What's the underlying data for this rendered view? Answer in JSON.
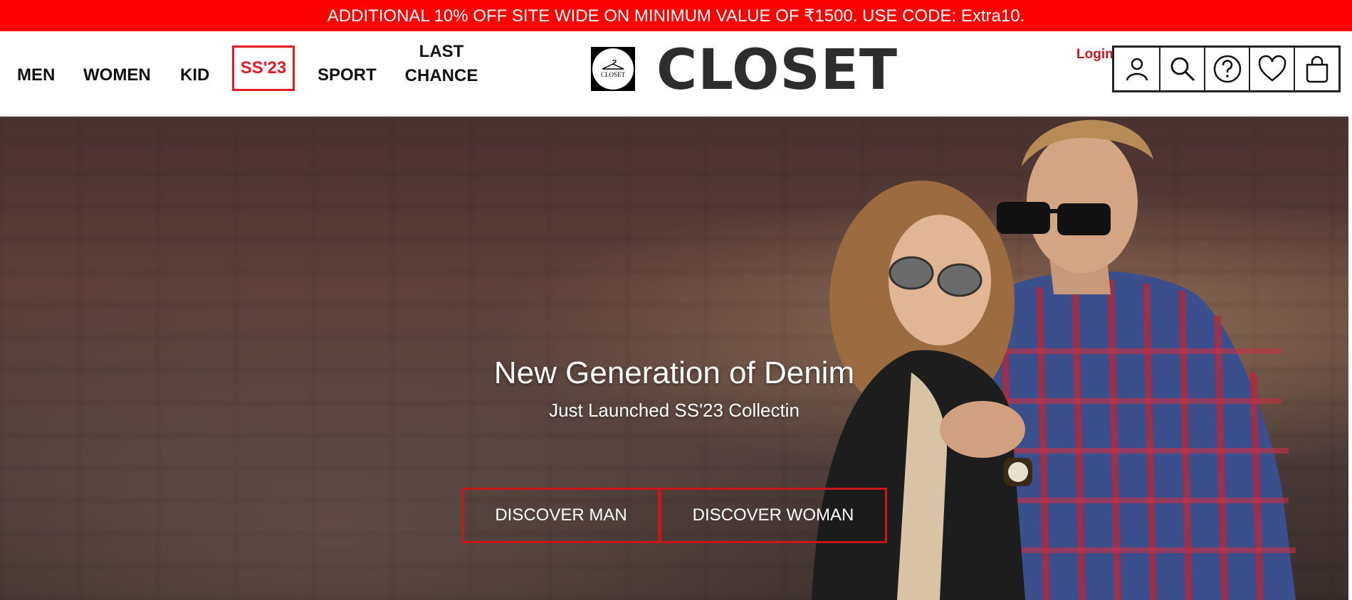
{
  "promo": {
    "text": "ADDITIONAL 10% OFF SITE WIDE ON MINIMUM VALUE OF ₹1500. USE CODE: Extra10."
  },
  "nav": {
    "items": [
      {
        "label": "MEN"
      },
      {
        "label": "WOMEN"
      },
      {
        "label": "KID"
      },
      {
        "label": "SS'23"
      },
      {
        "label": "SPORT"
      },
      {
        "label": "LAST CHANCE"
      }
    ]
  },
  "brand": {
    "name": "CLOSET",
    "badge_text": "CLOSET"
  },
  "account": {
    "login_label": "Login"
  },
  "toolbar_icons": [
    "user-icon",
    "search-icon",
    "help-icon",
    "heart-icon",
    "bag-icon"
  ],
  "hero": {
    "heading": "New Generation of Denim",
    "subheading": "Just Launched SS'23 Collectin",
    "buttons": [
      {
        "label": "DISCOVER MAN"
      },
      {
        "label": "DISCOVER WOMAN"
      }
    ]
  },
  "colors": {
    "promo_bg": "#ff0000",
    "accent": "#e31b23",
    "text_dark": "#111111"
  }
}
